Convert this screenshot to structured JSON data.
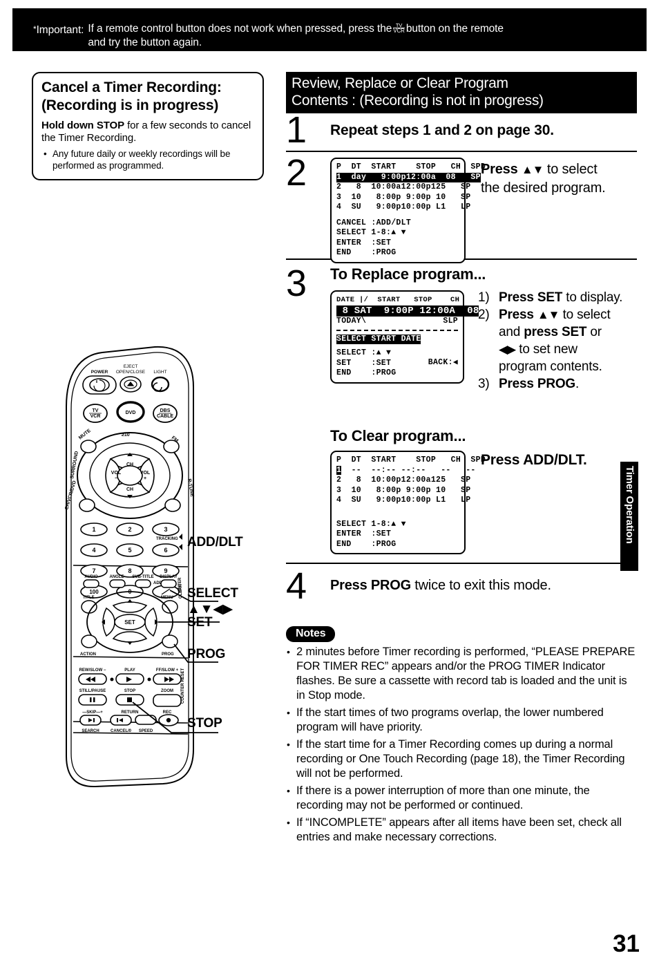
{
  "important": {
    "star": "*",
    "label": "Important:",
    "line1_a": "If a remote control button does not work when pressed, press the",
    "button_top": "TV",
    "button_bottom": "VCR",
    "line1_b": "button on the remote",
    "line2": "and try the button again."
  },
  "cancel_box": {
    "title_line1": "Cancel a Timer Recording:",
    "title_line2": "(Recording is in progress)",
    "lead_bold": "Hold down STOP",
    "lead_rest": " for a few seconds to cancel the Timer Recording.",
    "bullet": "Any future daily or weekly recordings will be performed as programmed."
  },
  "section_header": {
    "line1": "Review, Replace or Clear Program",
    "line2": "Contents : (Recording is not in progress)"
  },
  "steps": {
    "step1": {
      "number": "1",
      "text": "Repeat steps 1 and 2 on page 30."
    },
    "step2": {
      "number": "2",
      "instruction_a": "Press ",
      "instruction_arrows": "▲▼",
      "instruction_b": " to select",
      "instruction_c": "the desired program."
    },
    "step3": {
      "number": "3",
      "heading": "To Replace program...",
      "items": [
        {
          "n": "1)",
          "bold1": "Press SET",
          "rest1": " to display."
        },
        {
          "n": "2)",
          "bold1": "Press ",
          "arrows": "▲▼",
          "rest1": " to select",
          "line2_a": "and ",
          "line2_bold": "press SET",
          "line2_b": " or",
          "line3_arrows": "◀▶",
          "line3_rest": " to set new",
          "line4": "program contents."
        },
        {
          "n": "3)",
          "bold1": "Press PROG",
          "rest1": "."
        }
      ]
    },
    "clear": {
      "heading": "To Clear program...",
      "instruction": "Press ADD/DLT."
    },
    "step4": {
      "number": "4",
      "bold": "Press PROG",
      "rest": " twice to exit this mode."
    }
  },
  "osd_review": {
    "header": "P  DT  START    STOP   CH  SPD",
    "rows": [
      {
        "text": "1  day   9:00p12:00a  08   SP",
        "highlight": true
      },
      {
        "text": "2   8  10:00a12:00p125   SP",
        "highlight": false
      },
      {
        "text": "3  10   8:00p 9:00p 10   SP",
        "highlight": false
      },
      {
        "text": "4  SU   9:00p10:00p L1   LP",
        "highlight": false
      }
    ],
    "footer": [
      "CANCEL :ADD/DLT",
      "SELECT 1-8:▲ ▼",
      "ENTER  :SET",
      "END    :PROG"
    ]
  },
  "osd_replace": {
    "header": "DATE |/  START   STOP    CH",
    "row_highlight": " 8 SAT  9:00P 12:00A  08",
    "row_today_left": "TODAY\\",
    "row_today_right": "SLP",
    "banner": "SELECT START DATE",
    "footer": [
      "SELECT :▲ ▼",
      "SET    :SET",
      "END    :PROG"
    ],
    "footer_back": "BACK:◀"
  },
  "osd_clear": {
    "header": "P  DT  START    STOP   CH  SPD",
    "row1_sel": "1",
    "row1_rest": "  --  --:-- --:--   --   --",
    "rows": [
      "2   8  10:00p12:00a125   SP",
      "3  10   8:00p 9:00p 10   SP",
      "4  SU   9:00p10:00p L1   LP"
    ],
    "footer": [
      "SELECT 1-8:▲ ▼",
      "ENTER  :SET",
      "END    :PROG"
    ]
  },
  "notes": {
    "pill": "Notes",
    "items": [
      "2 minutes before Timer recording is performed, “PLEASE PREPARE FOR TIMER REC” appears and/or the PROG TIMER Indicator flashes. Be sure a cassette with record tab is loaded and the unit is in Stop mode.",
      "If the start times of two programs overlap, the lower numbered program will have priority.",
      "If the start time for a Timer Recording comes up during a normal recording or One Touch Recording (page 18), the Timer Recording will not be performed.",
      "If there is a power interruption of more than one minute, the recording may not be performed or continued.",
      "If “INCOMPLETE” appears after all items have been set, check all entries and make necessary corrections."
    ]
  },
  "side_tab": {
    "label": "Timer Operation"
  },
  "page_number": "31",
  "remote": {
    "callouts": [
      {
        "key": "add_dlt",
        "label": "ADD/DLT"
      },
      {
        "key": "select",
        "label": "SELECT"
      },
      {
        "key": "select_arrows",
        "label": "▲▼◀▶"
      },
      {
        "key": "set",
        "label": "SET"
      },
      {
        "key": "prog",
        "label": "PROG"
      },
      {
        "key": "stop",
        "label": "STOP"
      }
    ],
    "buttons": {
      "power": "POWER",
      "eject": "EJECT",
      "open_close": "OPEN/CLOSE",
      "light": "LIGHT",
      "tv": "TV",
      "vcr": "VCR",
      "dvd": "DVD",
      "dbs": "DBS",
      "cable": "CABLE",
      "mute": "MUTE",
      "ten_plus": "≥10",
      "fm": "FM",
      "ch_up": "CH",
      "ch_down": "CH",
      "vol_minus": "VOL −",
      "vol_plus": "VOL +",
      "surround": "SURROUND",
      "ch_vcr": "CH/VCR/DVD",
      "rtune": "R-TUNE",
      "tracking": "TRACKING",
      "add_dlt_btn": "ADD/DLT",
      "clear": "CLEAR",
      "n1": "1",
      "n2": "2",
      "n3": "3",
      "n4": "4",
      "n5": "5",
      "n6": "6",
      "n7": "7",
      "n8": "8",
      "n9": "9",
      "n100": "100",
      "n0": "0",
      "audio": "AUDIO",
      "angle": "ANGLE",
      "subtitle": "SUB-TITLE",
      "display": "DISPLAY",
      "enter": "ENTER",
      "title": "TITLE",
      "menu": "MENU",
      "action": "ACTION",
      "prog_btn": "PROG",
      "rew_slow_minus": "REW/SLOW −",
      "play": "PLAY",
      "ff_slow_plus": "FF/SLOW +",
      "still_pause": "STILL/PAUSE",
      "stop_btn": "STOP",
      "zoom": "ZOOM",
      "skip": "SKIP",
      "search": "SEARCH",
      "cancel_zero": "CANCEL/0",
      "return": "RETURN",
      "speed": "SPEED",
      "rec": "REC",
      "counter_reset": "COUNTER RESET"
    }
  }
}
